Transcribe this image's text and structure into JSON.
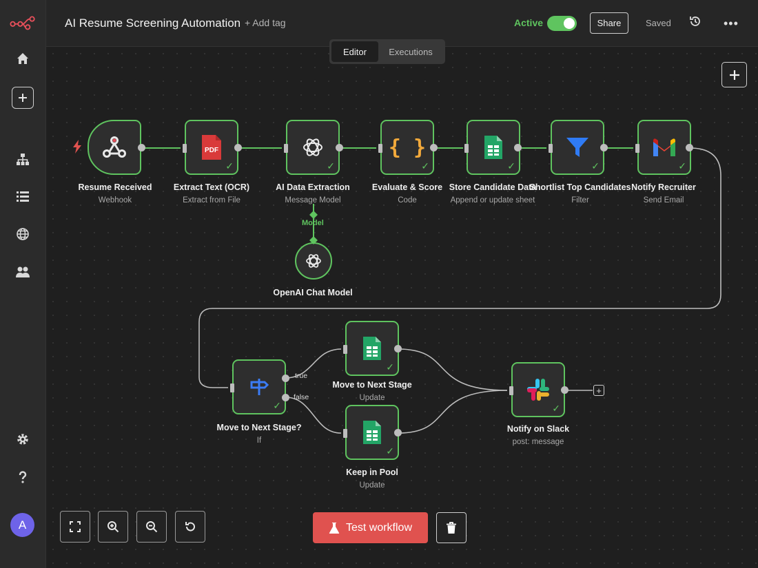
{
  "header": {
    "title": "AI Resume Screening Automation",
    "add_tag": "+ Add tag",
    "active_label": "Active",
    "active": true,
    "share_label": "Share",
    "saved_label": "Saved"
  },
  "tabs": {
    "editor": "Editor",
    "executions": "Executions"
  },
  "sidebar": {
    "items": [
      "home-icon",
      "plus-icon",
      "workflow-icon",
      "list-icon",
      "globe-icon",
      "users-icon",
      "gear-icon",
      "help-icon"
    ],
    "avatar": "A"
  },
  "nodes": {
    "resume_received": {
      "title": "Resume Received",
      "subtitle": "Webhook"
    },
    "extract_text": {
      "title": "Extract Text (OCR)",
      "subtitle": "Extract from File",
      "icon_text": "PDF"
    },
    "ai_extraction": {
      "title": "AI Data Extraction",
      "subtitle": "Message Model"
    },
    "evaluate": {
      "title": "Evaluate & Score",
      "subtitle": "Code",
      "icon_text": "{ }"
    },
    "store": {
      "title": "Store Candidate Data",
      "subtitle": "Append or update sheet"
    },
    "shortlist": {
      "title": "Shortlist Top Candidates",
      "subtitle": "Filter"
    },
    "notify_recruiter": {
      "title": "Notify Recruiter",
      "subtitle": "Send Email"
    },
    "openai_model": {
      "title": "OpenAI Chat Model"
    },
    "if_node": {
      "title": "Move to Next Stage?",
      "subtitle": "If"
    },
    "move_next": {
      "title": "Move to Next Stage",
      "subtitle": "Update"
    },
    "keep_pool": {
      "title": "Keep in Pool",
      "subtitle": "Update"
    },
    "slack": {
      "title": "Notify on Slack",
      "subtitle": "post: message"
    }
  },
  "edges": {
    "model_label": "Model",
    "true_label": "true",
    "false_label": "false"
  },
  "footer": {
    "test_label": "Test workflow"
  },
  "colors": {
    "accent": "#5fc45f",
    "test": "#e0524f",
    "avatar": "#6e63e8"
  }
}
